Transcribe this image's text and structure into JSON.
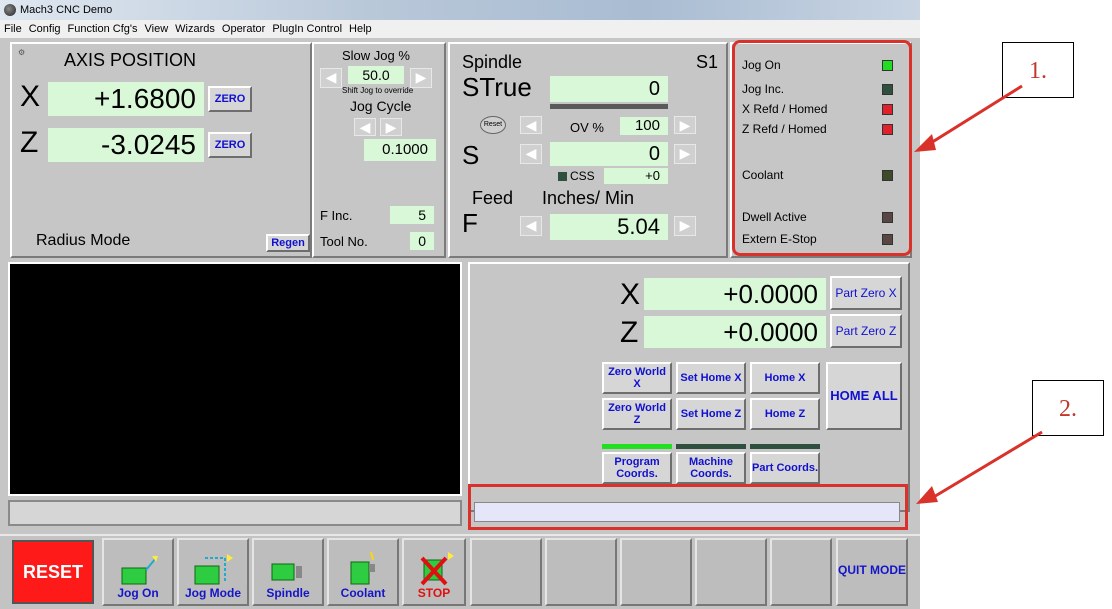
{
  "window": {
    "title": "Mach3 CNC  Demo"
  },
  "menu": [
    "File",
    "Config",
    "Function Cfg's",
    "View",
    "Wizards",
    "Operator",
    "PlugIn Control",
    "Help"
  ],
  "axis": {
    "title": "AXIS POSITION",
    "x_label": "X",
    "x_value": "+1.6800",
    "z_label": "Z",
    "z_value": "-3.0245",
    "zero_label": "ZERO",
    "radius_mode": "Radius Mode",
    "regen": "Regen"
  },
  "jog": {
    "slow_jog_label": "Slow Jog %",
    "slow_jog_value": "50.0",
    "shift_hint": "Shift Jog to override",
    "jog_cycle_label": "Jog Cycle",
    "jog_cycle_value": "0.1000",
    "f_inc_label": "F Inc.",
    "f_inc_value": "5",
    "tool_no_label": "Tool No.",
    "tool_no_value": "0"
  },
  "spindle": {
    "title": "Spindle",
    "s1": "S1",
    "strue_label": "STrue",
    "strue_value": "0",
    "reset_label": "Reset",
    "ov_label": "OV %",
    "ov_value": "100",
    "s_label": "S",
    "s_value": "0",
    "css_label": "CSS",
    "css_value": "+0",
    "feed_label": "Feed",
    "feed_units": "Inches/ Min",
    "f_label": "F",
    "f_value": "5.04"
  },
  "status": {
    "items": [
      {
        "label": "Jog On",
        "color": "#22dd22"
      },
      {
        "label": "Jog Inc.",
        "color": "#2f4f3f"
      },
      {
        "label": "X Refd / Homed",
        "color": "#e0202a"
      },
      {
        "label": "Z Refd / Homed",
        "color": "#e0202a"
      },
      {
        "label": "Coolant",
        "color": "#3f4a2a"
      },
      {
        "label": "Dwell Active",
        "color": "#5a4545"
      },
      {
        "label": "Extern E-Stop",
        "color": "#5a4545"
      }
    ]
  },
  "coords": {
    "x_label": "X",
    "x_value": "+0.0000",
    "z_label": "Z",
    "z_value": "+0.0000",
    "part_zero_x": "Part Zero X",
    "part_zero_z": "Part Zero Z",
    "zero_world_x": "Zero World X",
    "zero_world_z": "Zero World Z",
    "set_home_x": "Set Home X",
    "set_home_z": "Set Home Z",
    "home_x": "Home X",
    "home_z": "Home Z",
    "home_all": "HOME ALL",
    "program_coords": "Program Coords.",
    "machine_coords": "Machine Coords.",
    "part_coords": "Part Coords."
  },
  "toolbar": {
    "reset": "RESET",
    "jog_on": "Jog On",
    "jog_mode": "Jog Mode",
    "spindle": "Spindle",
    "coolant": "Coolant",
    "stop": "STOP",
    "quit_mode": "QUIT MODE"
  },
  "callouts": {
    "one": "1.",
    "two": "2."
  },
  "colors": {
    "annotation": "#d9322b",
    "dro_bg": "#d8f8d8",
    "button_text": "#1010d0",
    "reset_bg": "#ff1a1a"
  }
}
